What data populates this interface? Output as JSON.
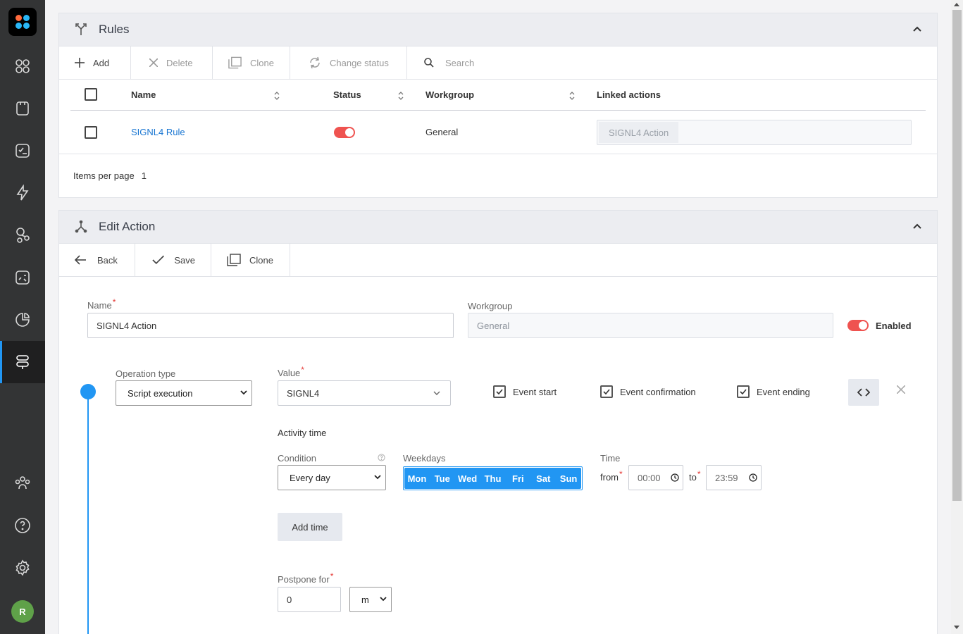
{
  "colors": {
    "accent": "#2196f3",
    "danger": "#ef5350",
    "sidebar": "#333435"
  },
  "sidebar": {
    "items": [
      {
        "icon": "dashboard-icon"
      },
      {
        "icon": "devices-icon"
      },
      {
        "icon": "checklist-icon"
      },
      {
        "icon": "events-lightning-icon"
      },
      {
        "icon": "topology-icon"
      },
      {
        "icon": "reports-icon"
      },
      {
        "icon": "statistics-pie-icon"
      },
      {
        "icon": "rules-icon"
      },
      {
        "icon": "users-icon"
      },
      {
        "icon": "help-icon"
      },
      {
        "icon": "settings-gear-icon"
      }
    ],
    "avatar_letter": "R"
  },
  "rules": {
    "title": "Rules",
    "toolbar": {
      "add": "Add",
      "delete": "Delete",
      "clone": "Clone",
      "change_status": "Change status",
      "search": "Search"
    },
    "columns": {
      "name": "Name",
      "status": "Status",
      "workgroup": "Workgroup",
      "linked": "Linked actions"
    },
    "rows": [
      {
        "name": "SIGNL4 Rule",
        "status": "enabled",
        "workgroup": "General",
        "linked": "SIGNL4 Action"
      }
    ],
    "items_per_page_label": "Items per page",
    "items_per_page": "1"
  },
  "edit_action": {
    "title": "Edit Action",
    "toolbar": {
      "back": "Back",
      "save": "Save",
      "clone": "Clone"
    },
    "name_label": "Name",
    "name_value": "SIGNL4 Action",
    "workgroup_label": "Workgroup",
    "workgroup_value": "General",
    "enabled_label": "Enabled",
    "operation_type_label": "Operation type",
    "operation_type_value": "Script execution",
    "value_label": "Value",
    "value_value": "SIGNL4",
    "event_start": "Event start",
    "event_confirmation": "Event confirmation",
    "event_ending": "Event ending",
    "activity_time_label": "Activity time",
    "condition_label": "Condition",
    "condition_value": "Every day",
    "weekdays_label": "Weekdays",
    "weekdays": [
      "Mon",
      "Tue",
      "Wed",
      "Thu",
      "Fri",
      "Sat",
      "Sun"
    ],
    "time_label": "Time",
    "from_label": "from",
    "from_value": "00:00",
    "to_label": "to",
    "to_value": "23:59",
    "add_time": "Add time",
    "postpone_label": "Postpone for",
    "postpone_value": "0",
    "postpone_unit": "m"
  }
}
